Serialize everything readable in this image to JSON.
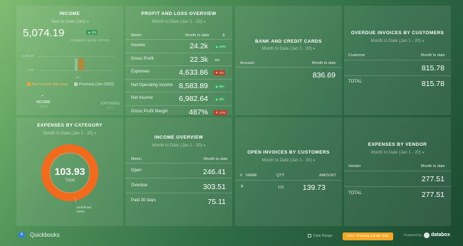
{
  "income": {
    "title": "INCOME",
    "period": "Year to Date (Jan)",
    "value": "5,074.19",
    "pct_badge": "▲ 0%",
    "comparison": "Comparison period: 5,074.19",
    "ytick_high": "5,000.00",
    "ytick_low": "0.00",
    "xtick": "Jan",
    "legend_current": "Net income this year",
    "legend_previous": "Previous (Jan 2022)",
    "tab_income": "INCOME",
    "tab_income_sub": "5,074",
    "tab_expenses": "EXPENSES",
    "tab_expenses_sub": "5,074",
    "bar_fraction": 0.85
  },
  "pnl": {
    "title": "PROFIT AND LOSS OVERVIEW",
    "period": "Month to Date (Jan 1 - 20)",
    "col_metric": "Metric",
    "col_mtd": "Month to date",
    "col_delta": "Δ",
    "rows": [
      {
        "label": "Income",
        "value": "24.2k",
        "badge": "▲ 19%",
        "badge_color": "green"
      },
      {
        "label": "Gross Profit",
        "value": "22.3k",
        "badge": "8%",
        "badge_color": "plain"
      },
      {
        "label": "Expenses",
        "value": "4,633.86",
        "badge": "▼ 4%",
        "badge_color": "red"
      },
      {
        "label": "Net Operating Income",
        "value": "8,583.89",
        "badge": "▲ 5%",
        "badge_color": "green"
      },
      {
        "label": "Net Income",
        "value": "6,982.64",
        "badge": "▲ 6%",
        "badge_color": "green"
      },
      {
        "label": "Gross Profit Margin",
        "value": "487%",
        "badge": "▼ 13%",
        "badge_color": "red"
      }
    ]
  },
  "bank": {
    "title": "BANK AND CREDIT CARDS",
    "period": "Month to Date (Jan 1 - 20)",
    "col_account": "Account",
    "col_mtd": "Month to date",
    "value": "836.69"
  },
  "overdue": {
    "title": "OVERDUE INVOICES BY CUSTOMERS",
    "period": "Month to Date (Jan 1 - 20)",
    "col_customer": "Customer",
    "col_mtd": "Month to date",
    "value": "815.78",
    "total_label": "TOTAL",
    "total_value": "815.78"
  },
  "expenses_cat": {
    "title": "EXPENSES BY CATEGORY",
    "period": "Month to Date (Jan 1 - 20)",
    "center_value": "103.93",
    "center_label": "Total",
    "slice_label": "undefined",
    "slice_pct": "100%",
    "ring_color": "#f26b1d"
  },
  "income_overview": {
    "title": "INCOME OVERVIEW",
    "period": "Month to Date (Jan 1 - 20)",
    "col_metric": "Metric",
    "col_mtd": "Month to date",
    "rows": [
      {
        "label": "Open",
        "value": "246.41"
      },
      {
        "label": "Overdue",
        "value": "303.51"
      },
      {
        "label": "Paid 30 days",
        "value": "75.11"
      }
    ]
  },
  "open_invoices": {
    "title": "OPEN INVOICES BY CUSTOMERS",
    "period": "Month to Date (Jan 1 - 20)",
    "col_hash": "#",
    "col_name": "NAME",
    "col_qty": "QTY",
    "col_amount": "AMOUNT",
    "row_icon": "¥",
    "row_qty": "121",
    "row_amount": "139.73"
  },
  "vendor": {
    "title": "EXPENSES BY VENDOR",
    "period": "Month to Date (Jan 1 - 20)",
    "col_vendor": "Vendor",
    "col_mtd": "Month to date",
    "value": "277.51",
    "total_label": "TOTAL",
    "total_value": "277.51"
  },
  "footer": {
    "app_name": "Quickbooks",
    "date_range": "Date Range",
    "note": "Note: Showing sample data",
    "powered_by": "Powered by",
    "brand": "databox"
  }
}
